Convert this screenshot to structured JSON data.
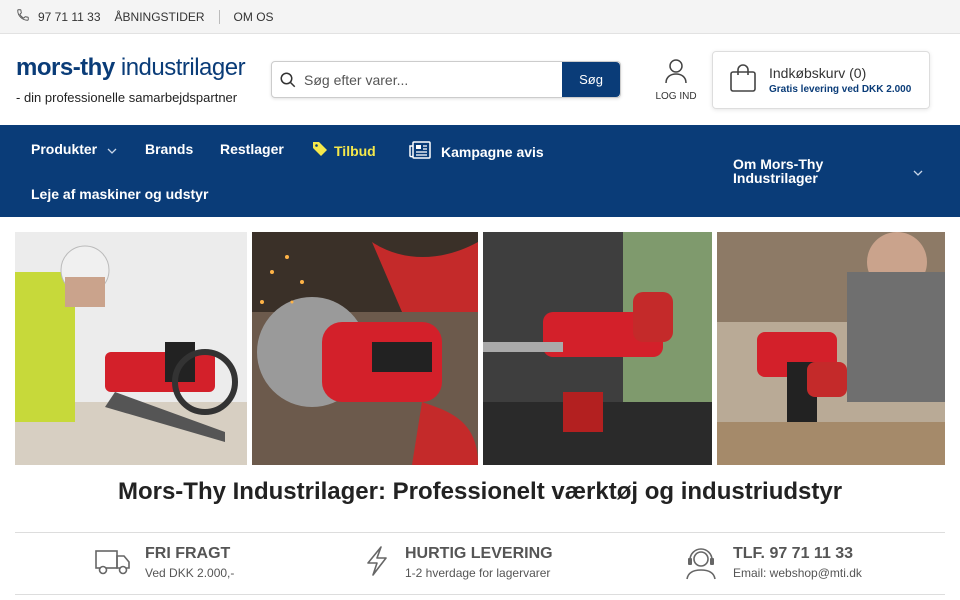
{
  "topbar": {
    "phone": "97 71 11 33",
    "opening_hours": "ÅBNINGSTIDER",
    "about": "OM OS"
  },
  "logo": {
    "name_part1": "mors-thy",
    "name_part2": " industrilager",
    "tagline": "- din professionelle samarbejdspartner"
  },
  "search": {
    "placeholder": "Søg efter varer...",
    "button": "Søg"
  },
  "login": {
    "label": "LOG IND"
  },
  "cart": {
    "label": "Indkøbskurv (0)",
    "note": "Gratis levering ved DKK 2.000"
  },
  "nav": {
    "products": "Produkter",
    "brands": "Brands",
    "rest": "Restlager",
    "offers": "Tilbud",
    "campaign": "Kampagne avis",
    "about_line1": "Om Mors-Thy",
    "about_line2": "Industrilager",
    "rental": "Leje af maskiner og udstyr"
  },
  "headline": "Mors-Thy Industrilager: Professionelt værktøj og industriudstyr",
  "usps": [
    {
      "title": "FRI FRAGT",
      "sub": "Ved DKK 2.000,-",
      "icon": "truck-icon"
    },
    {
      "title": "HURTIG LEVERING",
      "sub": "1-2 hverdage for lagervarer",
      "icon": "lightning-icon"
    },
    {
      "title": "TLF. 97 71 11 33",
      "sub": "Email: webshop@mti.dk",
      "icon": "support-icon"
    }
  ],
  "colors": {
    "brand": "#0a3c78",
    "offer": "#f5e84b",
    "tool_red": "#d3202a"
  }
}
